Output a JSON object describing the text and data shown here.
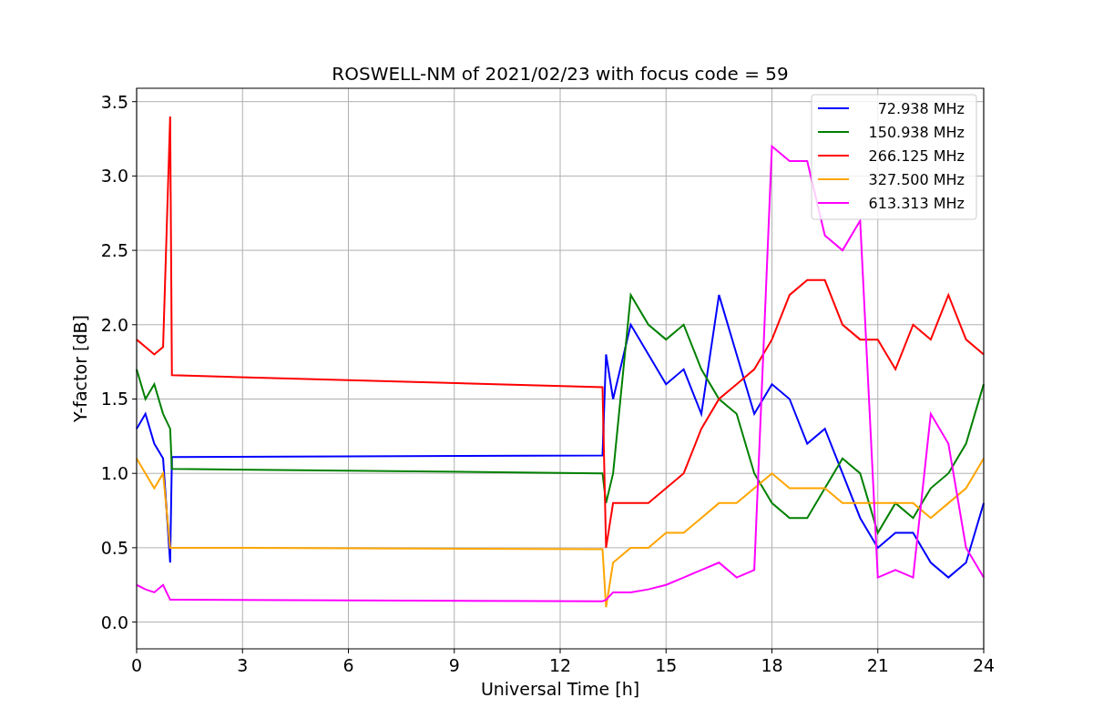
{
  "figure": {
    "chart_data": {
      "type": "line",
      "title": "ROSWELL-NM of 2021/02/23 with focus code = 59",
      "xlabel": "Universal Time [h]",
      "ylabel": "Y-factor [dB]",
      "x": [
        0,
        0.25,
        0.5,
        0.75,
        0.95,
        1,
        13.2,
        13.3,
        13.5,
        14,
        14.5,
        15,
        15.5,
        16,
        16.5,
        17,
        17.5,
        18,
        18.5,
        19,
        19.5,
        20,
        20.5,
        21,
        21.5,
        22,
        22.5,
        23,
        23.5,
        24
      ],
      "series": [
        {
          "name": "72.938 MHz",
          "color": "#0000ff",
          "values": [
            1.3,
            1.4,
            1.2,
            1.1,
            0.4,
            1.11,
            1.12,
            1.8,
            1.5,
            2.0,
            1.8,
            1.6,
            1.7,
            1.4,
            2.2,
            1.8,
            1.4,
            1.6,
            1.5,
            1.2,
            1.3,
            1.0,
            0.7,
            0.5,
            0.6,
            0.6,
            0.4,
            0.3,
            0.4,
            0.8
          ]
        },
        {
          "name": "150.938 MHz",
          "color": "#008000",
          "values": [
            1.7,
            1.5,
            1.6,
            1.4,
            1.3,
            1.03,
            1.0,
            0.8,
            1.0,
            2.2,
            2.0,
            1.9,
            2.0,
            1.7,
            1.5,
            1.4,
            1.0,
            0.8,
            0.7,
            0.7,
            0.9,
            1.1,
            1.0,
            0.6,
            0.8,
            0.7,
            0.9,
            1.0,
            1.2,
            1.6
          ]
        },
        {
          "name": "266.125 MHz",
          "color": "#ff0000",
          "values": [
            1.9,
            1.85,
            1.8,
            1.85,
            3.4,
            1.66,
            1.58,
            0.5,
            0.8,
            0.8,
            0.8,
            0.9,
            1.0,
            1.3,
            1.5,
            1.6,
            1.7,
            1.9,
            2.2,
            2.3,
            2.3,
            2.0,
            1.9,
            1.9,
            1.7,
            2.0,
            1.9,
            2.2,
            1.9,
            1.8
          ]
        },
        {
          "name": "327.500 MHz",
          "color": "#ffa500",
          "values": [
            1.1,
            1.0,
            0.9,
            1.0,
            0.5,
            0.5,
            0.49,
            0.1,
            0.4,
            0.5,
            0.5,
            0.6,
            0.6,
            0.7,
            0.8,
            0.8,
            0.9,
            1.0,
            0.9,
            0.9,
            0.9,
            0.8,
            0.8,
            0.8,
            0.8,
            0.8,
            0.7,
            0.8,
            0.9,
            1.1
          ]
        },
        {
          "name": "613.313 MHz",
          "color": "#ff00ff",
          "values": [
            0.25,
            0.22,
            0.2,
            0.25,
            0.15,
            0.15,
            0.14,
            0.15,
            0.2,
            0.2,
            0.22,
            0.25,
            0.3,
            0.35,
            0.4,
            0.3,
            0.35,
            3.2,
            3.1,
            3.1,
            2.6,
            2.5,
            2.7,
            0.3,
            0.35,
            0.3,
            1.4,
            1.2,
            0.5,
            0.3
          ]
        }
      ],
      "grid": true,
      "legend": true,
      "xlim": [
        0,
        24
      ],
      "ylim": [
        -0.18,
        3.59
      ],
      "xticks": [
        0,
        3,
        6,
        9,
        12,
        15,
        18,
        21,
        24
      ],
      "yticks": [
        {
          "value": 0,
          "label": "0.0"
        },
        {
          "value": 0.5,
          "label": "0.5"
        },
        {
          "value": 1,
          "label": "1.0"
        },
        {
          "value": 1.5,
          "label": "1.5"
        },
        {
          "value": 2,
          "label": "2.0"
        },
        {
          "value": 2.5,
          "label": "2.5"
        },
        {
          "value": 3,
          "label": "3.0"
        },
        {
          "value": 3.5,
          "label": "3.5"
        }
      ]
    }
  }
}
